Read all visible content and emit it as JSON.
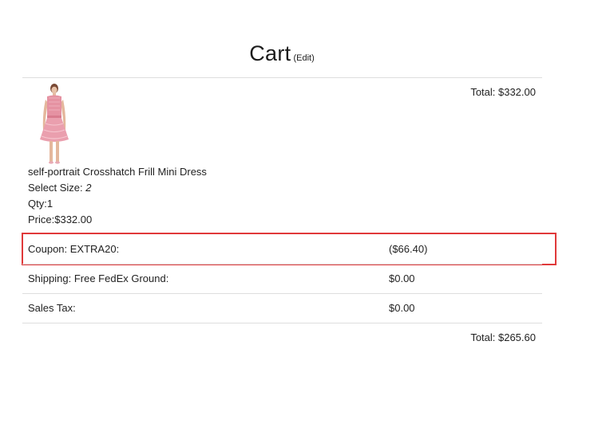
{
  "header": {
    "title": "Cart",
    "edit_label": "(Edit)"
  },
  "item": {
    "total": "Total: $332.00",
    "image_alt": "pink dress",
    "name": "self-portrait Crosshatch Frill Mini Dress",
    "size_label": "Select Size: ",
    "size_value": "2",
    "qty": "Qty:1",
    "price": "Price:$332.00"
  },
  "summary": {
    "coupon_label": "Coupon: EXTRA20:",
    "coupon_value": "($66.40)",
    "shipping_label": "Shipping: Free FedEx Ground:",
    "shipping_value": "$0.00",
    "tax_label": "Sales Tax:",
    "tax_value": "$0.00",
    "highlight_color": "#e0393a"
  },
  "footer": {
    "total": "Total: $265.60"
  }
}
